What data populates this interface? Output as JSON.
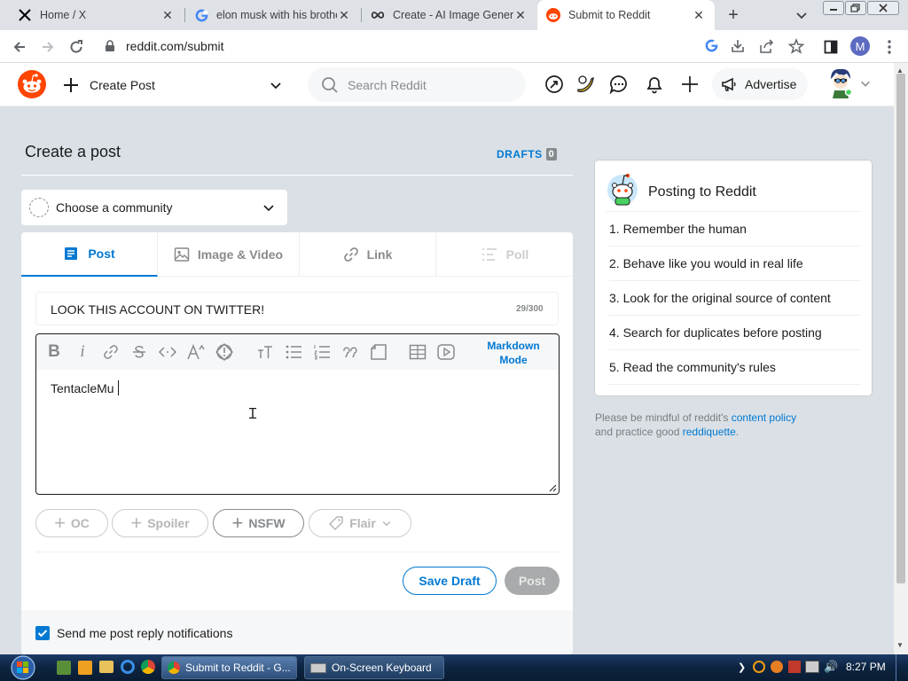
{
  "browser": {
    "tabs": [
      {
        "title": "Home / X",
        "icon": "x-logo-icon"
      },
      {
        "title": "elon musk with his brothe",
        "icon": "google-icon"
      },
      {
        "title": "Create - AI Image Genera",
        "icon": "infinity-icon"
      },
      {
        "title": "Submit to Reddit",
        "icon": "reddit-icon"
      }
    ],
    "new_tab": "+",
    "url": "reddit.com/submit",
    "profile_initial": "M"
  },
  "header": {
    "create_post_label": "Create Post",
    "search_placeholder": "Search Reddit",
    "advertise_label": "Advertise"
  },
  "page": {
    "title": "Create a post",
    "drafts_label": "DRAFTS",
    "drafts_count": "0",
    "community_placeholder": "Choose a community",
    "post_tabs": [
      {
        "label": "Post",
        "icon": "document-icon",
        "active": true
      },
      {
        "label": "Image & Video",
        "icon": "image-icon",
        "active": false
      },
      {
        "label": "Link",
        "icon": "link-icon",
        "active": false
      },
      {
        "label": "Poll",
        "icon": "poll-icon",
        "active": false
      }
    ],
    "title_value": "LOOK THIS ACCOUNT ON TWITTER!",
    "title_counter": "29/300",
    "markdown_mode": "Markdown Mode",
    "body_text": "TentacleMu",
    "tags": [
      "OC",
      "Spoiler",
      "NSFW",
      "Flair"
    ],
    "save_draft_label": "Save Draft",
    "post_label": "Post",
    "notify_label": "Send me post reply notifications"
  },
  "sidebar": {
    "title": "Posting to Reddit",
    "rules": [
      "1. Remember the human",
      "2. Behave like you would in real life",
      "3. Look for the original source of content",
      "4. Search for duplicates before posting",
      "5. Read the community's rules"
    ],
    "footer_pre": "Please be mindful of reddit's ",
    "footer_link1": "content policy",
    "footer_mid": "and practice good ",
    "footer_link2": "reddiquette",
    "footer_end": "."
  },
  "taskbar": {
    "items": [
      "Submit to Reddit - G...",
      "On-Screen Keyboard"
    ],
    "clock": "8:27 PM"
  },
  "colors": {
    "accent": "#0079d3",
    "reddit_orange": "#ff4500",
    "page_bg": "#dae0e6"
  }
}
